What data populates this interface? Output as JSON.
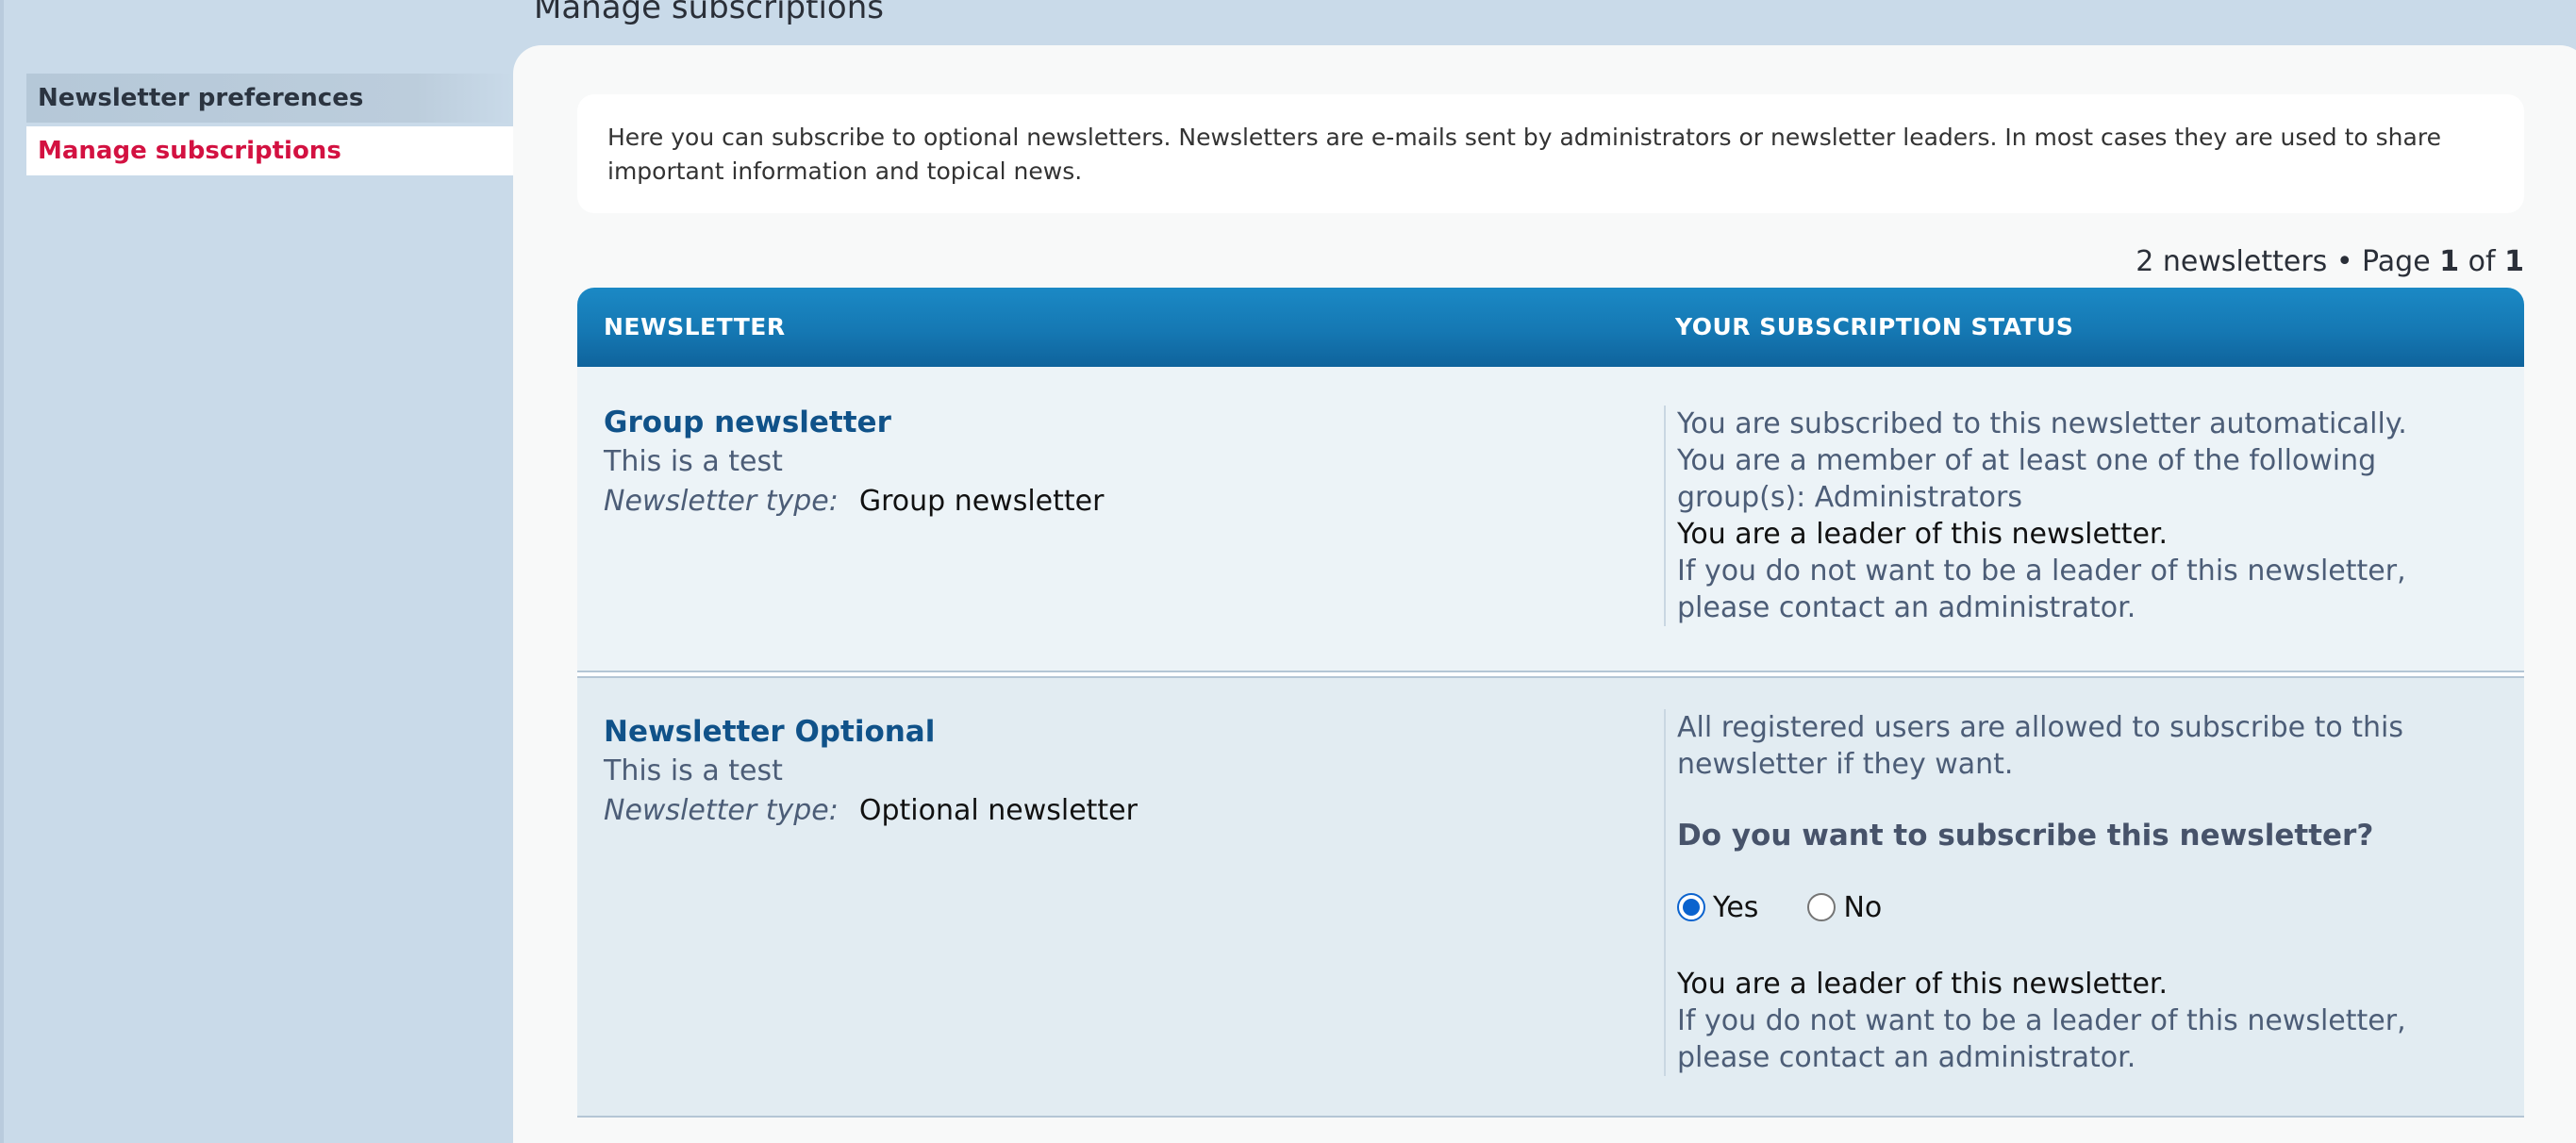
{
  "page": {
    "title": "Manage subscriptions"
  },
  "sidebar": {
    "header": "Newsletter preferences",
    "items": [
      {
        "label": "Manage subscriptions",
        "active": true
      }
    ]
  },
  "intro": {
    "text": "Here you can subscribe to optional newsletters. Newsletters are e-mails sent by administrators or newsletter leaders. In most cases they are used to share important information and topical news."
  },
  "pagination": {
    "count_text": "2 newsletters • Page",
    "current": "1",
    "of_text": "of",
    "total": "1"
  },
  "table": {
    "headers": {
      "newsletter": "NEWSLETTER",
      "status": "YOUR SUBSCRIPTION STATUS"
    },
    "type_label": "Newsletter type:",
    "rows": [
      {
        "title": "Group newsletter",
        "description": "This is a test",
        "type": "Group newsletter",
        "status_lines": [
          "You are subscribed to this newsletter automatically.",
          "You are a member of at least one of the following group(s): Administrators"
        ],
        "leader_text": "You are a leader of this newsletter.",
        "leader_note": "If you do not want to be a leader of this newsletter, please contact an administrator."
      },
      {
        "title": "Newsletter Optional",
        "description": "This is a test",
        "type": "Optional newsletter",
        "status_lines": [
          "All registered users are allowed to subscribe to this newsletter if they want."
        ],
        "question": "Do you want to subscribe this newsletter?",
        "options": [
          {
            "label": "Yes",
            "checked": true
          },
          {
            "label": "No",
            "checked": false
          }
        ],
        "leader_text": "You are a leader of this newsletter.",
        "leader_note": "If you do not want to be a leader of this newsletter, please contact an administrator."
      }
    ]
  },
  "colors": {
    "background": "#c9dae9",
    "accent_link": "#d31141",
    "title_link": "#105289",
    "header_blue": "#1578b3",
    "radio_checked": "#0b63ce"
  }
}
